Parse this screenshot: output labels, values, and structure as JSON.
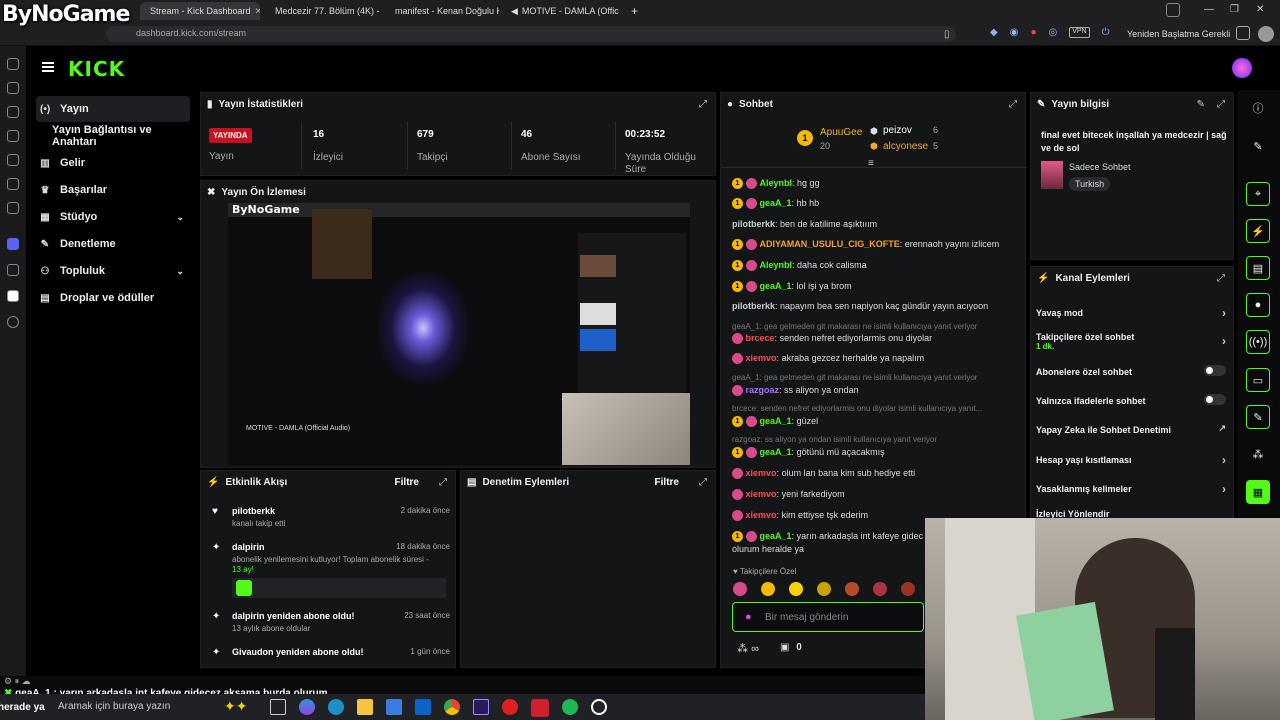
{
  "browser": {
    "tabs": [
      {
        "label": "Stream - Kick Dashboard",
        "active": true
      },
      {
        "label": "Medcezir 77. Bölüm (4K) - "
      },
      {
        "label": "manifest - Kenan Doğulu K"
      },
      {
        "label": "MOTIVE - DAMLA (Official"
      }
    ],
    "url": "dashboard.kick.com/stream",
    "restart_label": "Yeniden Başlatma Gerekli",
    "vpn_label": "VPN"
  },
  "overlay_logo": "ByNoGame",
  "kick_logo": "KICK",
  "nav": {
    "items": [
      {
        "label": "Yayın",
        "icon": "broadcast-icon",
        "active": true
      },
      {
        "label": "Yayın Bağlantısı ve Anahtarı",
        "icon": ""
      },
      {
        "label": "Gelir",
        "icon": "chart-icon"
      },
      {
        "label": "Başarılar",
        "icon": "trophy-icon"
      },
      {
        "label": "Stüdyo",
        "icon": "studio-icon"
      },
      {
        "label": "Denetleme",
        "icon": "wrench-icon"
      },
      {
        "label": "Topluluk",
        "icon": "people-icon"
      },
      {
        "label": "Droplar ve ödüller",
        "icon": "gift-icon"
      }
    ]
  },
  "stats": {
    "title": "Yayın İstatistikleri",
    "live_badge": "YAYINDA",
    "items": [
      {
        "value": "",
        "label": "Yayın"
      },
      {
        "value": "16",
        "label": "İzleyici"
      },
      {
        "value": "679",
        "label": "Takipçi"
      },
      {
        "value": "46",
        "label": "Abone Sayısı"
      },
      {
        "value": "00:23:52",
        "label": "Yayında Olduğu Süre"
      }
    ]
  },
  "preview": {
    "title": "Yayın Ön İzlemesi",
    "overlay_text": "ByNoGame",
    "caption": "MOTIVE - DAMLA (Official Audio)"
  },
  "activity": {
    "title": "Etkinlik Akışı",
    "filter": "Filtre",
    "items": [
      {
        "title": "pilotberkk",
        "sub": "kanalı takip etti",
        "time": "2 dakika önce",
        "icon": "heart-icon"
      },
      {
        "title": "dalpirin",
        "sub": "abonelik yenilemesini kutluyor! Toplam abonelik süresi -",
        "sub2": "13 ay!",
        "time": "18 dakika önce",
        "icon": "star-icon"
      },
      {
        "title": "dalpirin yeniden abone oldu!",
        "sub": "13 aylık abone oldular",
        "time": "23 saat önce",
        "icon": "sparkle-icon"
      },
      {
        "title": "Givaudon yeniden abone oldu!",
        "sub": "",
        "time": "1 gün önce",
        "icon": "sparkle-icon"
      }
    ]
  },
  "moderation": {
    "title": "Denetim Eylemleri",
    "filter": "Filtre"
  },
  "chat": {
    "title": "Sohbet",
    "leaders": [
      {
        "name": "ApuuGee",
        "count": "20"
      },
      {
        "name": "peizov",
        "count": "6"
      },
      {
        "name": "alcyonese",
        "count": "5"
      }
    ],
    "messages": [
      {
        "user": "Aleynbl",
        "text": "hg gg",
        "color": "#53fc18"
      },
      {
        "user": "geaA_1",
        "text": "hb hb",
        "color": "#53fc18"
      },
      {
        "user": "pilotberkk",
        "text": "ben de katilime aşıktııım",
        "color": "#cccccc"
      },
      {
        "user": "ADIYAMAN_USULU_CIG_KOFTE",
        "text": "erennaoh yayını izlicem",
        "color": "#f5a623"
      },
      {
        "user": "Aleynbl",
        "text": "daha cok calisma",
        "color": "#53fc18"
      },
      {
        "user": "geaA_1",
        "text": "lol işi ya brom",
        "color": "#53fc18"
      },
      {
        "user": "pilotberkk",
        "text": "napayım bea sen napiyon kaç gündür yayın acıyoon",
        "color": "#cccccc"
      },
      {
        "reply": "geaA_1: gea gelmeden git makarası ne isimli kullanıcıya yanıt veriyor"
      },
      {
        "user": "brcece",
        "text": "senden nefret ediyorlarmis onu diyolar",
        "color": "#ff4d4d"
      },
      {
        "user": "xiemvo",
        "text": "akraba gezcez herhalde ya napalım",
        "color": "#ff4d4d"
      },
      {
        "reply": "geaA_1: gea gelmeden git makarası ne isimli kullanıcıya yanıt veriyor"
      },
      {
        "user": "razgoaz",
        "text": "ss aliyon ya ondan",
        "color": "#a970ff"
      },
      {
        "reply": "brcece: senden nefret ediyorlarmis onu diyolar isimli kullanıcıya yanıt..."
      },
      {
        "user": "geaA_1",
        "text": "güzel",
        "color": "#53fc18"
      },
      {
        "reply": "razgoaz: ss aliyon ya ondan isimli kullanıcıya yanıt veriyor"
      },
      {
        "user": "geaA_1",
        "text": "götünü mü açacakmış",
        "color": "#53fc18"
      },
      {
        "user": "xiemvo",
        "text": "olum lan bana kim sub hediye etti",
        "color": "#ff4d4d"
      },
      {
        "user": "xiemvo",
        "text": "yeni farkediyom",
        "color": "#ff4d4d"
      },
      {
        "user": "xiemvo",
        "text": "kim ettiyse tşk ederim",
        "color": "#ff4d4d"
      },
      {
        "user": "geaA_1",
        "text": "yarın arkadaşla int kafeye gidec",
        "color": "#53fc18"
      },
      {
        "cont": "olurum heralde ya"
      }
    ],
    "followers_only": "Takipçilere Özel",
    "input_placeholder": "Bir mesaj gönderin",
    "footer_count": "0",
    "footer_infinity": "∞"
  },
  "stream_info": {
    "title": "Yayın bilgisi",
    "stream_title": "final evet bitecek inşallah ya medcezir | sağ ve de sol",
    "category": "Sadece Sohbet",
    "tag": "Turkish"
  },
  "channel_actions": {
    "title": "Kanal Eylemleri",
    "items": [
      {
        "label": "Yavaş mod",
        "kind": "chevron"
      },
      {
        "label": "Takipçilere özel sohbet",
        "sub": "1 dk.",
        "kind": "chevron"
      },
      {
        "label": "Abonelere özel sohbet",
        "kind": "toggle"
      },
      {
        "label": "Yalnızca ifadelerle sohbet",
        "kind": "toggle"
      },
      {
        "label": "Yapay Zeka ile Sohbet Denetimi",
        "kind": "external"
      },
      {
        "label": "Hesap yaşı kısıtlaması",
        "kind": "chevron"
      },
      {
        "label": "Yasaklanmış kelimeler",
        "kind": "chevron"
      },
      {
        "label": "İzleyici Yönlendir",
        "kind": "none"
      }
    ]
  },
  "ticker": {
    "text": "geaA_1 : yarın arkadaşla int kafeye gidecez akşama burda olurum",
    "side": "herade ya"
  },
  "taskbar": {
    "search_placeholder": "Aramak için buraya yazın"
  },
  "colors": {
    "kick_green": "#53fc18",
    "live_red": "#c90e1e",
    "panel_bg": "#141517"
  }
}
